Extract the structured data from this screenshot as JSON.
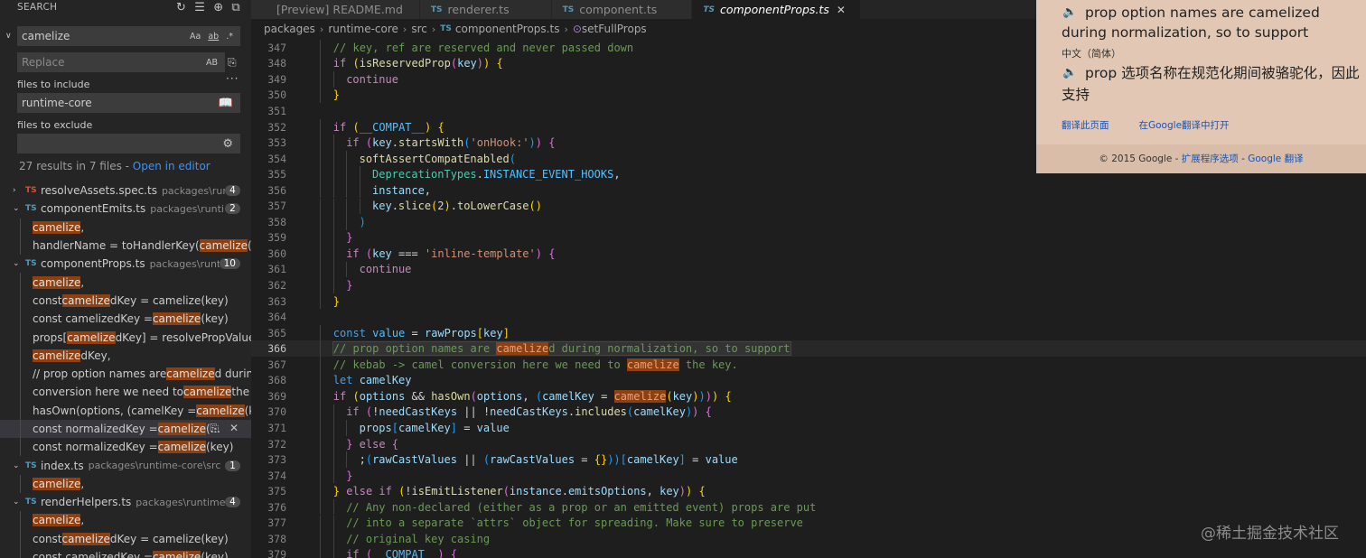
{
  "sidebar": {
    "title": "SEARCH",
    "search_value": "camelize",
    "replace_placeholder": "Replace",
    "match_case": "Aa",
    "whole_word": "ab",
    "regex": ".*",
    "preserve_case": "AB",
    "files_to_include_label": "files to include",
    "files_to_include_value": "runtime-core",
    "files_to_exclude_label": "files to exclude",
    "results_summary": "27 results in 7 files - ",
    "open_in_editor": "Open in editor"
  },
  "results": [
    {
      "kind": "file",
      "lang": "TS",
      "lang_color": "#e44d26",
      "name": "resolveAssets.spec.ts",
      "path": "packages\\runti...",
      "count": "4",
      "expanded": false
    },
    {
      "kind": "file",
      "lang": "TS",
      "name": "componentEmits.ts",
      "path": "packages\\runtim...",
      "count": "2",
      "expanded": true
    },
    {
      "kind": "match",
      "pre": "",
      "hit": "camelize",
      "post": ","
    },
    {
      "kind": "match",
      "pre": "handlerName = toHandlerKey(",
      "hit": "camelize",
      "post": "(eve..."
    },
    {
      "kind": "file",
      "lang": "TS",
      "name": "componentProps.ts",
      "path": "packages\\runti...",
      "count": "10",
      "expanded": true
    },
    {
      "kind": "match",
      "pre": "",
      "hit": "camelize",
      "post": ","
    },
    {
      "kind": "match",
      "pre": "const ",
      "hit": "camelize",
      "post": "dKey = camelize(key)"
    },
    {
      "kind": "match",
      "pre": "const camelizedKey = ",
      "hit": "camelize",
      "post": "(key)"
    },
    {
      "kind": "match",
      "pre": "props[",
      "hit": "camelize",
      "post": "dKey] = resolvePropValue("
    },
    {
      "kind": "match",
      "pre": "",
      "hit": "camelize",
      "post": "dKey,"
    },
    {
      "kind": "match",
      "pre": "// prop option names are ",
      "hit": "camelize",
      "post": "d during ..."
    },
    {
      "kind": "match",
      "pre": "conversion here we need to ",
      "hit": "camelize",
      "post": " the key."
    },
    {
      "kind": "match",
      "pre": "hasOwn(options, (camelKey = ",
      "hit": "camelize",
      "post": "(key)..."
    },
    {
      "kind": "match",
      "pre": "const normalizedKey = ",
      "hit": "camelize",
      "post": "(...",
      "selected": true
    },
    {
      "kind": "match",
      "pre": "const normalizedKey = ",
      "hit": "camelize",
      "post": "(key)"
    },
    {
      "kind": "file",
      "lang": "TS",
      "name": "index.ts",
      "path": "packages\\runtime-core\\src",
      "count": "1",
      "expanded": true
    },
    {
      "kind": "match",
      "pre": "",
      "hit": "camelize",
      "post": ","
    },
    {
      "kind": "file",
      "lang": "TS",
      "name": "renderHelpers.ts",
      "path": "packages\\runtime-c...",
      "count": "4",
      "expanded": true
    },
    {
      "kind": "match",
      "pre": "",
      "hit": "camelize",
      "post": ","
    },
    {
      "kind": "match",
      "pre": "const ",
      "hit": "camelize",
      "post": "dKey = camelize(key)"
    },
    {
      "kind": "match",
      "pre": "const camelizedKey = ",
      "hit": "camelize",
      "post": "(key)"
    }
  ],
  "tabs": [
    {
      "label": "[Preview] README.md",
      "icon": "preview-icon",
      "active": false
    },
    {
      "label": "renderer.ts",
      "icon": "TS",
      "active": false
    },
    {
      "label": "component.ts",
      "icon": "TS",
      "active": false
    },
    {
      "label": "componentProps.ts",
      "icon": "TS",
      "active": true
    }
  ],
  "breadcrumb": [
    "packages",
    "runtime-core",
    "src",
    "componentProps.ts",
    "setFullProps"
  ],
  "editor": {
    "current_line": "366",
    "lines": [
      {
        "n": "347",
        "indent": 2,
        "tokens": [
          [
            "cm",
            "// key, ref are reserved and never passed down"
          ]
        ]
      },
      {
        "n": "348",
        "indent": 2,
        "tokens": [
          [
            "kw",
            "if "
          ],
          [
            "b1",
            "("
          ],
          [
            "fn",
            "isReservedProp"
          ],
          [
            "b2",
            "("
          ],
          [
            "vr",
            "key"
          ],
          [
            "b2",
            ")"
          ],
          [
            "b1",
            ")"
          ],
          [
            "pn",
            " "
          ],
          [
            "b1",
            "{"
          ]
        ]
      },
      {
        "n": "349",
        "indent": 3,
        "tokens": [
          [
            "kw",
            "continue"
          ]
        ]
      },
      {
        "n": "350",
        "indent": 2,
        "tokens": [
          [
            "b1",
            "}"
          ]
        ]
      },
      {
        "n": "351",
        "indent": 0,
        "tokens": []
      },
      {
        "n": "352",
        "indent": 2,
        "tokens": [
          [
            "kw",
            "if "
          ],
          [
            "b1",
            "("
          ],
          [
            "cn",
            "__COMPAT__"
          ],
          [
            "b1",
            ")"
          ],
          [
            "pn",
            " "
          ],
          [
            "b1",
            "{"
          ]
        ]
      },
      {
        "n": "353",
        "indent": 3,
        "tokens": [
          [
            "kw",
            "if "
          ],
          [
            "b2",
            "("
          ],
          [
            "vr",
            "key"
          ],
          [
            "pn",
            "."
          ],
          [
            "fn",
            "startsWith"
          ],
          [
            "b3",
            "("
          ],
          [
            "st",
            "'onHook:'"
          ],
          [
            "b3",
            ")"
          ],
          [
            "b2",
            ")"
          ],
          [
            "pn",
            " "
          ],
          [
            "b2",
            "{"
          ]
        ]
      },
      {
        "n": "354",
        "indent": 4,
        "tokens": [
          [
            "fn",
            "softAssertCompatEnabled"
          ],
          [
            "b3",
            "("
          ]
        ]
      },
      {
        "n": "355",
        "indent": 5,
        "tokens": [
          [
            "ty",
            "DeprecationTypes"
          ],
          [
            "pn",
            "."
          ],
          [
            "cn",
            "INSTANCE_EVENT_HOOKS"
          ],
          [
            "pn",
            ","
          ]
        ]
      },
      {
        "n": "356",
        "indent": 5,
        "tokens": [
          [
            "vr",
            "instance"
          ],
          [
            "pn",
            ","
          ]
        ]
      },
      {
        "n": "357",
        "indent": 5,
        "tokens": [
          [
            "vr",
            "key"
          ],
          [
            "pn",
            "."
          ],
          [
            "fn",
            "slice"
          ],
          [
            "b1",
            "("
          ],
          [
            "pn",
            "2"
          ],
          [
            "b1",
            ")"
          ],
          [
            "pn",
            "."
          ],
          [
            "fn",
            "toLowerCase"
          ],
          [
            "b1",
            "()"
          ]
        ]
      },
      {
        "n": "358",
        "indent": 4,
        "tokens": [
          [
            "b3",
            ")"
          ]
        ]
      },
      {
        "n": "359",
        "indent": 3,
        "tokens": [
          [
            "b2",
            "}"
          ]
        ]
      },
      {
        "n": "360",
        "indent": 3,
        "tokens": [
          [
            "kw",
            "if "
          ],
          [
            "b2",
            "("
          ],
          [
            "vr",
            "key"
          ],
          [
            "pn",
            " === "
          ],
          [
            "st",
            "'inline-template'"
          ],
          [
            "b2",
            ")"
          ],
          [
            "pn",
            " "
          ],
          [
            "b2",
            "{"
          ]
        ]
      },
      {
        "n": "361",
        "indent": 4,
        "tokens": [
          [
            "kw",
            "continue"
          ]
        ]
      },
      {
        "n": "362",
        "indent": 3,
        "tokens": [
          [
            "b2",
            "}"
          ]
        ]
      },
      {
        "n": "363",
        "indent": 2,
        "tokens": [
          [
            "b1",
            "}"
          ]
        ]
      },
      {
        "n": "364",
        "indent": 0,
        "tokens": []
      },
      {
        "n": "365",
        "indent": 2,
        "tokens": [
          [
            "kb",
            "const "
          ],
          [
            "cn",
            "value"
          ],
          [
            "pn",
            " = "
          ],
          [
            "vr",
            "rawProps"
          ],
          [
            "b1",
            "["
          ],
          [
            "vr",
            "key"
          ],
          [
            "b1",
            "]"
          ]
        ]
      },
      {
        "n": "366",
        "indent": 2,
        "tokens": [
          [
            "cm",
            "// prop option names are "
          ],
          [
            "chl",
            "camelize"
          ],
          [
            "cm",
            "d during normalization, so to support"
          ]
        ]
      },
      {
        "n": "367",
        "indent": 2,
        "tokens": [
          [
            "cm",
            "// kebab -> camel conversion here we need to "
          ],
          [
            "chl",
            "camelize"
          ],
          [
            "cm",
            " the key."
          ]
        ]
      },
      {
        "n": "368",
        "indent": 2,
        "tokens": [
          [
            "kb",
            "let "
          ],
          [
            "vr",
            "camelKey"
          ]
        ]
      },
      {
        "n": "369",
        "indent": 2,
        "tokens": [
          [
            "kw",
            "if "
          ],
          [
            "b1",
            "("
          ],
          [
            "vr",
            "options"
          ],
          [
            "pn",
            " && "
          ],
          [
            "fn",
            "hasOwn"
          ],
          [
            "b2",
            "("
          ],
          [
            "vr",
            "options"
          ],
          [
            "pn",
            ", "
          ],
          [
            "b3",
            "("
          ],
          [
            "vr",
            "camelKey"
          ],
          [
            "pn",
            " = "
          ],
          [
            "chl",
            "camelize"
          ],
          [
            "b1",
            "("
          ],
          [
            "vr",
            "key"
          ],
          [
            "b1",
            ")"
          ],
          [
            "b3",
            ")"
          ],
          [
            "b2",
            ")"
          ],
          [
            "b1",
            ")"
          ],
          [
            "pn",
            " "
          ],
          [
            "b1",
            "{"
          ]
        ]
      },
      {
        "n": "370",
        "indent": 3,
        "tokens": [
          [
            "kw",
            "if "
          ],
          [
            "b2",
            "("
          ],
          [
            "pn",
            "!"
          ],
          [
            "vr",
            "needCastKeys"
          ],
          [
            "pn",
            " || !"
          ],
          [
            "vr",
            "needCastKeys"
          ],
          [
            "pn",
            "."
          ],
          [
            "fn",
            "includes"
          ],
          [
            "b3",
            "("
          ],
          [
            "vr",
            "camelKey"
          ],
          [
            "b3",
            ")"
          ],
          [
            "b2",
            ")"
          ],
          [
            "pn",
            " "
          ],
          [
            "b2",
            "{"
          ]
        ]
      },
      {
        "n": "371",
        "indent": 4,
        "tokens": [
          [
            "vr",
            "props"
          ],
          [
            "b3",
            "["
          ],
          [
            "vr",
            "camelKey"
          ],
          [
            "b3",
            "]"
          ],
          [
            "pn",
            " = "
          ],
          [
            "vr",
            "value"
          ]
        ]
      },
      {
        "n": "372",
        "indent": 3,
        "tokens": [
          [
            "b2",
            "}"
          ],
          [
            "pn",
            " "
          ],
          [
            "kw",
            "else "
          ],
          [
            "b2",
            "{"
          ]
        ]
      },
      {
        "n": "373",
        "indent": 4,
        "tokens": [
          [
            "pn",
            ";"
          ],
          [
            "b3",
            "("
          ],
          [
            "vr",
            "rawCastValues"
          ],
          [
            "pn",
            " || "
          ],
          [
            "b3",
            "("
          ],
          [
            "vr",
            "rawCastValues"
          ],
          [
            "pn",
            " = "
          ],
          [
            "b1",
            "{}"
          ],
          [
            "b3",
            "))"
          ],
          [
            "b3",
            "["
          ],
          [
            "vr",
            "camelKey"
          ],
          [
            "b3",
            "]"
          ],
          [
            "pn",
            " = "
          ],
          [
            "vr",
            "value"
          ]
        ]
      },
      {
        "n": "374",
        "indent": 3,
        "tokens": [
          [
            "b2",
            "}"
          ]
        ]
      },
      {
        "n": "375",
        "indent": 2,
        "tokens": [
          [
            "b1",
            "}"
          ],
          [
            "pn",
            " "
          ],
          [
            "kw",
            "else if "
          ],
          [
            "b1",
            "("
          ],
          [
            "pn",
            "!"
          ],
          [
            "fn",
            "isEmitListener"
          ],
          [
            "b2",
            "("
          ],
          [
            "vr",
            "instance"
          ],
          [
            "pn",
            "."
          ],
          [
            "vr",
            "emitsOptions"
          ],
          [
            "pn",
            ", "
          ],
          [
            "vr",
            "key"
          ],
          [
            "b2",
            ")"
          ],
          [
            "b1",
            ")"
          ],
          [
            "pn",
            " "
          ],
          [
            "b1",
            "{"
          ]
        ]
      },
      {
        "n": "376",
        "indent": 3,
        "tokens": [
          [
            "cm",
            "// Any non-declared (either as a prop or an emitted event) props are put"
          ]
        ]
      },
      {
        "n": "377",
        "indent": 3,
        "tokens": [
          [
            "cm",
            "// into a separate `attrs` object for spreading. Make sure to preserve"
          ]
        ]
      },
      {
        "n": "378",
        "indent": 3,
        "tokens": [
          [
            "cm",
            "// original key casing"
          ]
        ]
      },
      {
        "n": "379",
        "indent": 3,
        "tokens": [
          [
            "kw",
            "if "
          ],
          [
            "b2",
            "("
          ],
          [
            "cn",
            "__COMPAT__"
          ],
          [
            "b2",
            ")"
          ],
          [
            "pn",
            " "
          ],
          [
            "b2",
            "{"
          ]
        ]
      }
    ]
  },
  "popup": {
    "source_text": "prop option names are camelized during normalization, so to support",
    "target_lang": "中文（简体）",
    "translation": "prop 选项名称在规范化期间被骆驼化，因此支持",
    "link_translate_page": "翻译此页面",
    "link_open_google": "在Google翻译中打开",
    "footer_prefix": "© 2015 Google - ",
    "footer_ext": "扩展程序选项",
    "footer_sep": " - ",
    "footer_gt": "Google 翻译"
  },
  "watermark": "@稀土掘金技术社区"
}
